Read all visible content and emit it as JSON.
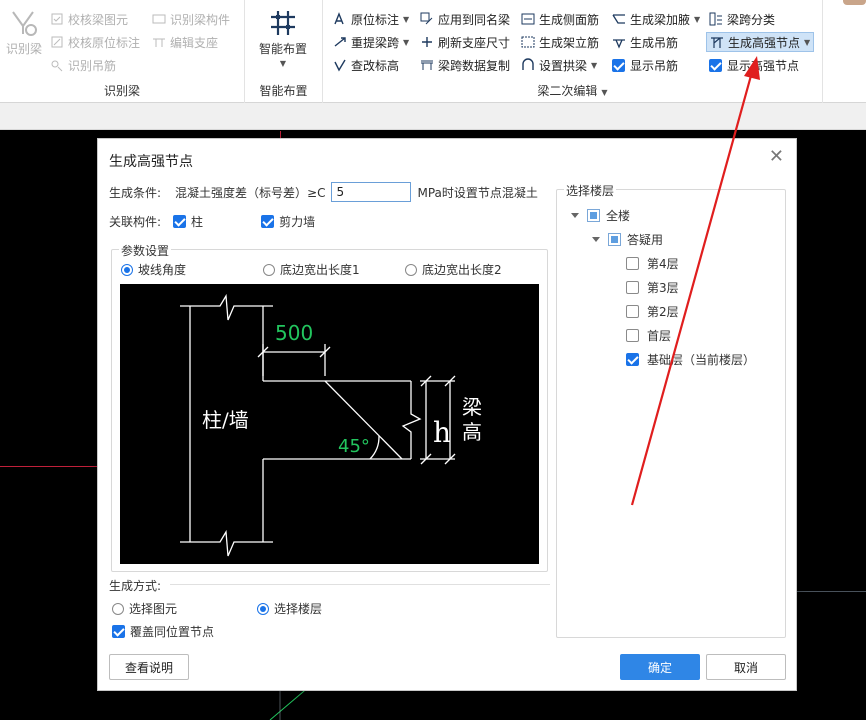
{
  "ribbon": {
    "group_identify": {
      "label": "识别梁",
      "big_button": "识别梁",
      "items": [
        "校核梁图元",
        "校核原位标注",
        "识别吊筋",
        "识别梁构件",
        "编辑支座"
      ]
    },
    "group_smart": {
      "label": "智能布置",
      "big_button": "智能布置"
    },
    "group_edit": {
      "label": "梁二次编辑",
      "col1": [
        "原位标注",
        "重提梁跨",
        "查改标高"
      ],
      "col2": [
        "应用到同名梁",
        "刷新支座尺寸",
        "梁跨数据复制"
      ],
      "col3": [
        "生成侧面筋",
        "生成架立筋",
        "设置拱梁"
      ],
      "col4": [
        "生成梁加腋",
        "生成吊筋",
        "显示吊筋"
      ],
      "col5": [
        "梁跨分类",
        "生成高强节点",
        "显示高强节点"
      ]
    }
  },
  "dialog": {
    "title": "生成高强节点",
    "condition_label": "生成条件:",
    "condition_text": "混凝土强度差（标号差）≥C",
    "condition_value": "5",
    "condition_suffix": "MPa时设置节点混凝土",
    "related_label": "关联构件:",
    "related_column": "柱",
    "related_wall": "剪力墙",
    "params_legend": "参数设置",
    "param_options": [
      "坡线角度",
      "底边宽出长度1",
      "底边宽出长度2"
    ],
    "diagram": {
      "dim_500": "500",
      "angle": "45°",
      "column_wall": "柱/墙",
      "h": "h",
      "beam_height_1": "梁",
      "beam_height_2": "高"
    },
    "method_label": "生成方式:",
    "method_options": [
      "选择图元",
      "选择楼层"
    ],
    "override_label": "覆盖同位置节点",
    "help_button": "查看说明",
    "ok_button": "确定",
    "cancel_button": "取消",
    "floor_panel": {
      "legend": "选择楼层",
      "root": "全楼",
      "group": "答疑用",
      "floors": [
        {
          "name": "第4层",
          "checked": false
        },
        {
          "name": "第3层",
          "checked": false
        },
        {
          "name": "第2层",
          "checked": false
        },
        {
          "name": "首层",
          "checked": false
        },
        {
          "name": "基础层（当前楼层）",
          "checked": true
        }
      ]
    }
  },
  "colors": {
    "accent": "#1a73e8",
    "annotation_arrow": "#e01e1e",
    "cad_background": "#000000",
    "dim_text_green": "#22c55e"
  }
}
